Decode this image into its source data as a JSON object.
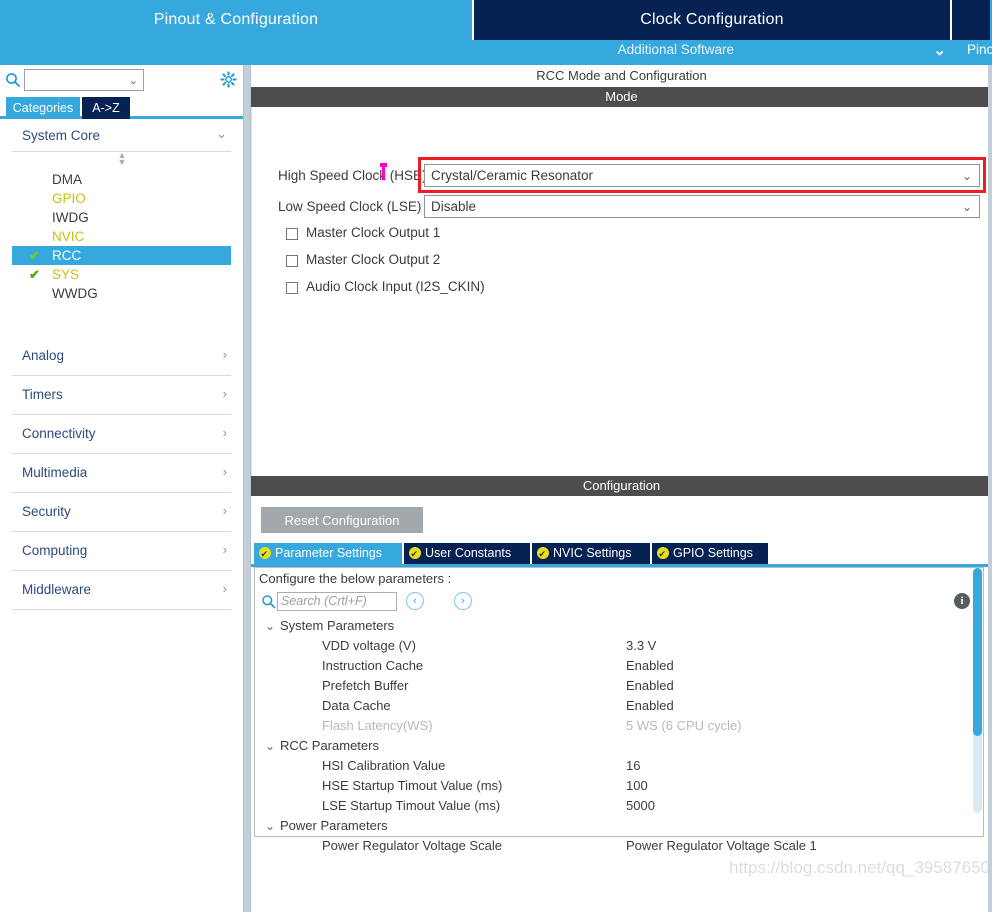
{
  "top_tabs": [
    {
      "label": "Pinout & Configuration",
      "state": "active"
    },
    {
      "label": "Clock Configuration",
      "state": "inactive"
    },
    {
      "label": "",
      "state": "inactive"
    }
  ],
  "second_bar": {
    "additional_software": "Additional Software",
    "pinout_right": "Pino",
    "chevron": "⌄"
  },
  "sidebar": {
    "search_value": "",
    "combo_chevron": "⌄",
    "tabs": [
      {
        "label": "Categories",
        "state": "active"
      },
      {
        "label": "A->Z",
        "state": "inactive"
      }
    ],
    "system_core": {
      "label": "System Core",
      "arrow": "⌄",
      "items": [
        {
          "label": "DMA",
          "color": "default",
          "checked": false,
          "selected": false
        },
        {
          "label": "GPIO",
          "color": "yellow",
          "checked": false,
          "selected": false
        },
        {
          "label": "IWDG",
          "color": "default",
          "checked": false,
          "selected": false
        },
        {
          "label": "NVIC",
          "color": "yellow",
          "checked": false,
          "selected": false
        },
        {
          "label": "RCC",
          "color": "default",
          "checked": true,
          "selected": true
        },
        {
          "label": "SYS",
          "color": "yellow",
          "checked": true,
          "selected": false
        },
        {
          "label": "WWDG",
          "color": "default",
          "checked": false,
          "selected": false
        }
      ]
    },
    "groups": [
      {
        "label": "Analog",
        "arrow": "›"
      },
      {
        "label": "Timers",
        "arrow": "›"
      },
      {
        "label": "Connectivity",
        "arrow": "›"
      },
      {
        "label": "Multimedia",
        "arrow": "›"
      },
      {
        "label": "Security",
        "arrow": "›"
      },
      {
        "label": "Computing",
        "arrow": "›"
      },
      {
        "label": "Middleware",
        "arrow": "›"
      }
    ]
  },
  "main": {
    "pane_title": "RCC Mode and Configuration",
    "mode_band": "Mode",
    "mode": {
      "hse_label": "High Speed Clock (HSE)",
      "hse_value": "Crystal/Ceramic Resonator",
      "lse_label": "Low Speed Clock (LSE)",
      "lse_value": "Disable",
      "chevron": "⌄",
      "checkboxes": [
        {
          "label": "Master Clock Output 1",
          "checked": false
        },
        {
          "label": "Master Clock Output 2",
          "checked": false
        },
        {
          "label": "Audio Clock Input (I2S_CKIN)",
          "checked": false
        }
      ]
    },
    "config_band": "Configuration",
    "reset_button": "Reset Configuration",
    "config_tabs": [
      {
        "label": "Parameter Settings",
        "state": "active"
      },
      {
        "label": "User Constants",
        "state": "inactive"
      },
      {
        "label": "NVIC Settings",
        "state": "inactive"
      },
      {
        "label": "GPIO Settings",
        "state": "inactive"
      }
    ],
    "config_hint": "Configure the below parameters :",
    "param_search_placeholder": "Search (Crtl+F)",
    "param_search_value": "",
    "nav_back": "‹",
    "nav_forward": "›",
    "info_glyph": "i",
    "param_groups": [
      {
        "name": "System Parameters",
        "toggle": "⌄",
        "rows": [
          {
            "name": "VDD voltage (V)",
            "value": "3.3 V",
            "disabled": false
          },
          {
            "name": "Instruction Cache",
            "value": "Enabled",
            "disabled": false
          },
          {
            "name": "Prefetch Buffer",
            "value": "Enabled",
            "disabled": false
          },
          {
            "name": "Data Cache",
            "value": "Enabled",
            "disabled": false
          },
          {
            "name": "Flash Latency(WS)",
            "value": "5 WS (6 CPU cycle)",
            "disabled": true
          }
        ]
      },
      {
        "name": "RCC Parameters",
        "toggle": "⌄",
        "rows": [
          {
            "name": "HSI Calibration Value",
            "value": "16",
            "disabled": false
          },
          {
            "name": "HSE Startup Timout Value (ms)",
            "value": "100",
            "disabled": false
          },
          {
            "name": "LSE Startup Timout Value (ms)",
            "value": "5000",
            "disabled": false
          }
        ]
      },
      {
        "name": "Power Parameters",
        "toggle": "⌄",
        "rows": [
          {
            "name": "Power Regulator Voltage Scale",
            "value": "Power Regulator Voltage Scale 1",
            "disabled": false
          }
        ]
      }
    ]
  },
  "watermark": "https://blog.csdn.net/qq_39587650",
  "colors": {
    "accent_light_blue": "#35a8dd",
    "accent_dark_navy": "#052252",
    "band_gray": "#4d4d4d",
    "highlight_red": "#ee1c25",
    "caret_magenta": "#ff00c8",
    "check_green": "#5aa813",
    "periph_yellow": "#c9c013",
    "tab_icon_yellow": "#e8dd1f"
  }
}
